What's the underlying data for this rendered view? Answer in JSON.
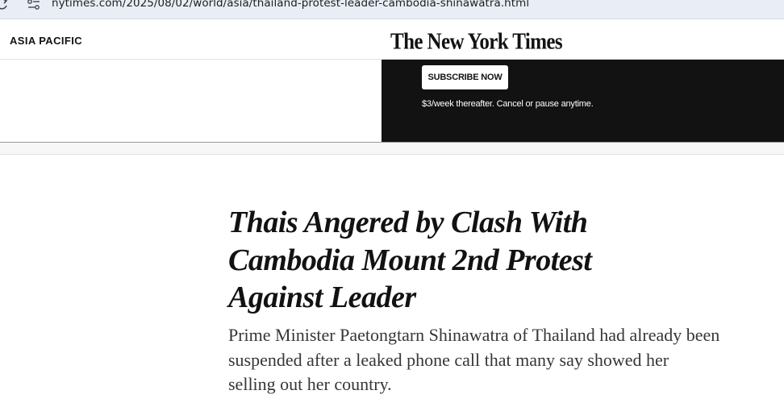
{
  "browser": {
    "url": "nytimes.com/2025/08/02/world/asia/thailand-protest-leader-cambodia-shinawatra.html"
  },
  "header": {
    "section": "ASIA PACIFIC",
    "logo": "The New York Times"
  },
  "banner": {
    "subscribe_label": "SUBSCRIBE NOW",
    "note": "$3/week thereafter. Cancel or pause anytime."
  },
  "article": {
    "headline": "Thais Angered by Clash With Cambodia Mount 2nd Protest Against Leader",
    "summary": "Prime Minister Paetongtarn Shinawatra of Thailand had already been suspended after a leaked phone call that many say showed her selling out her country."
  },
  "colors": {
    "browser_bar": "#e9eef6",
    "banner_dark": "#121212",
    "text_primary": "#121212",
    "text_summary": "#363636"
  }
}
